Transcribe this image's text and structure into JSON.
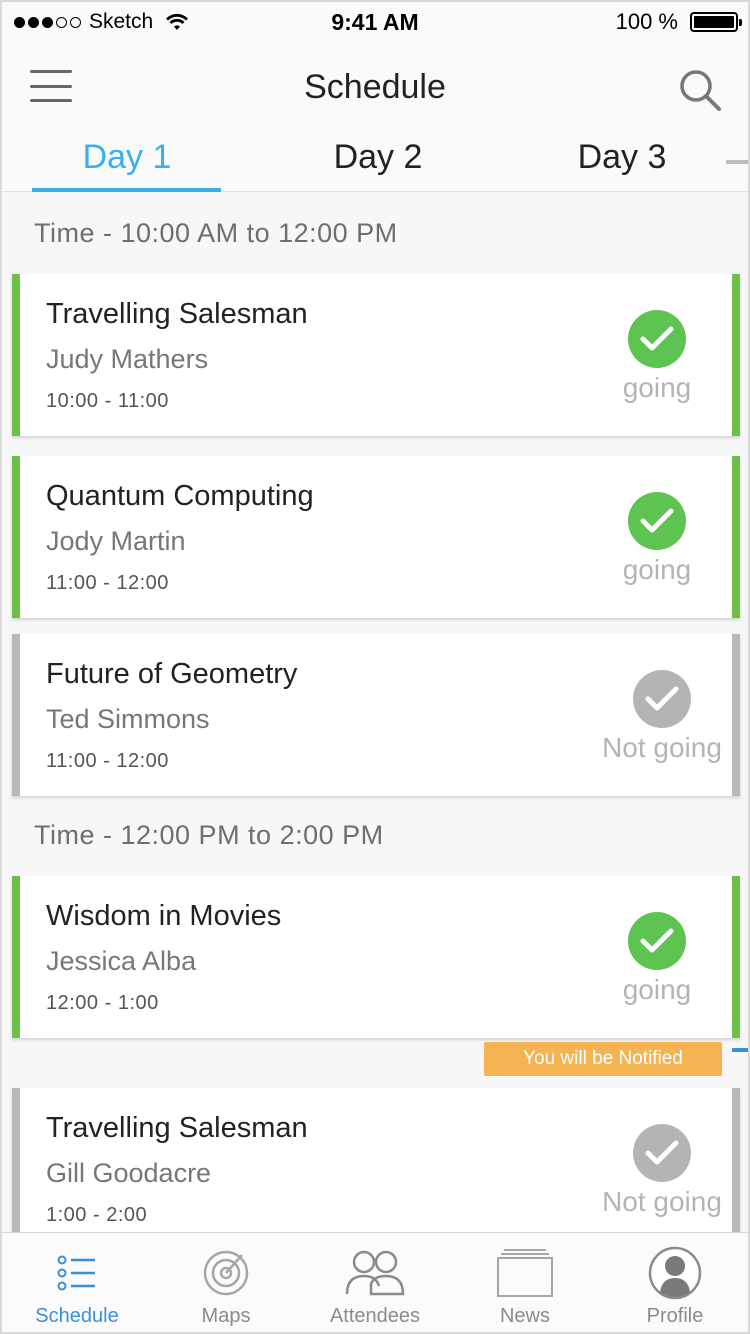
{
  "status_bar": {
    "carrier": "Sketch",
    "time": "9:41 AM",
    "battery": "100 %"
  },
  "header": {
    "title": "Schedule",
    "menu_icon": "hamburger-menu-icon",
    "search_icon": "search-icon"
  },
  "tabs": [
    {
      "label": "Day 1",
      "active": true
    },
    {
      "label": "Day 2",
      "active": false
    },
    {
      "label": "Day 3",
      "active": false
    }
  ],
  "sections": [
    {
      "label": "Time - 10:00 AM to 12:00 PM",
      "sessions": [
        {
          "title": "Travelling Salesman",
          "speaker": "Judy Mathers",
          "time": "10:00 - 11:00",
          "status": "going"
        },
        {
          "title": "Quantum Computing",
          "speaker": "Jody Martin",
          "time": "11:00 - 12:00",
          "status": "going"
        },
        {
          "title": "Future of Geometry",
          "speaker": "Ted Simmons",
          "time": "11:00 - 12:00",
          "status": "Not going"
        }
      ]
    },
    {
      "label": "Time - 12:00 PM to 2:00 PM",
      "sessions": [
        {
          "title": "Wisdom in Movies",
          "speaker": "Jessica Alba",
          "time": "12:00 - 1:00",
          "status": "going"
        },
        {
          "title": "Travelling Salesman",
          "speaker": "Gill Goodacre",
          "time": "1:00 - 2:00",
          "status": "Not going"
        }
      ]
    }
  ],
  "notification": "You will be Notified",
  "colors": {
    "accent": "#3ab0ea",
    "going": "#6cc04a",
    "not_going": "#b9b9b9",
    "notify": "#f6b352",
    "tab_active": "#3a8fd9"
  },
  "tabbar": [
    {
      "label": "Schedule",
      "icon": "list-icon",
      "active": true
    },
    {
      "label": "Maps",
      "icon": "target-map-icon",
      "active": false
    },
    {
      "label": "Attendees",
      "icon": "people-icon",
      "active": false
    },
    {
      "label": "News",
      "icon": "news-icon",
      "active": false
    },
    {
      "label": "Profile",
      "icon": "avatar-icon",
      "active": false
    }
  ]
}
